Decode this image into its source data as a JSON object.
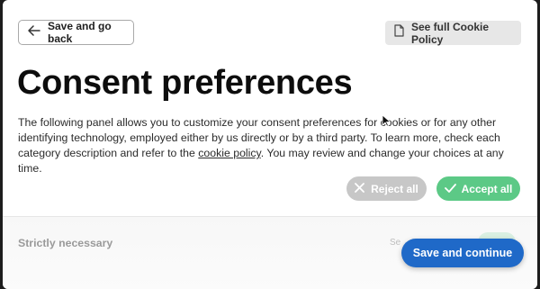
{
  "header": {
    "back_label": "Save and go back",
    "policy_label": "See full Cookie Policy"
  },
  "main": {
    "title": "Consent preferences",
    "description_pre": "The following panel allows you to customize your consent preferences for cookies or for any other identifying technology, employed either by us directly or by a third party. To learn more, check each category description and refer to the ",
    "description_link": "cookie policy",
    "description_post": ". You may review and change your choices at any time.",
    "reject_label": "Reject all",
    "accept_label": "Accept all"
  },
  "sections": {
    "strictly_necessary_title": "Strictly necessary",
    "toggle_hint": "Se"
  },
  "footer": {
    "save_label": "Save and continue"
  },
  "colors": {
    "accept": "#5cc986",
    "reject": "#c7c7c7",
    "save": "#1f69c8"
  },
  "icons": {
    "back": "arrow-left-icon",
    "policy": "document-icon",
    "reject": "close-icon",
    "accept": "check-icon"
  }
}
